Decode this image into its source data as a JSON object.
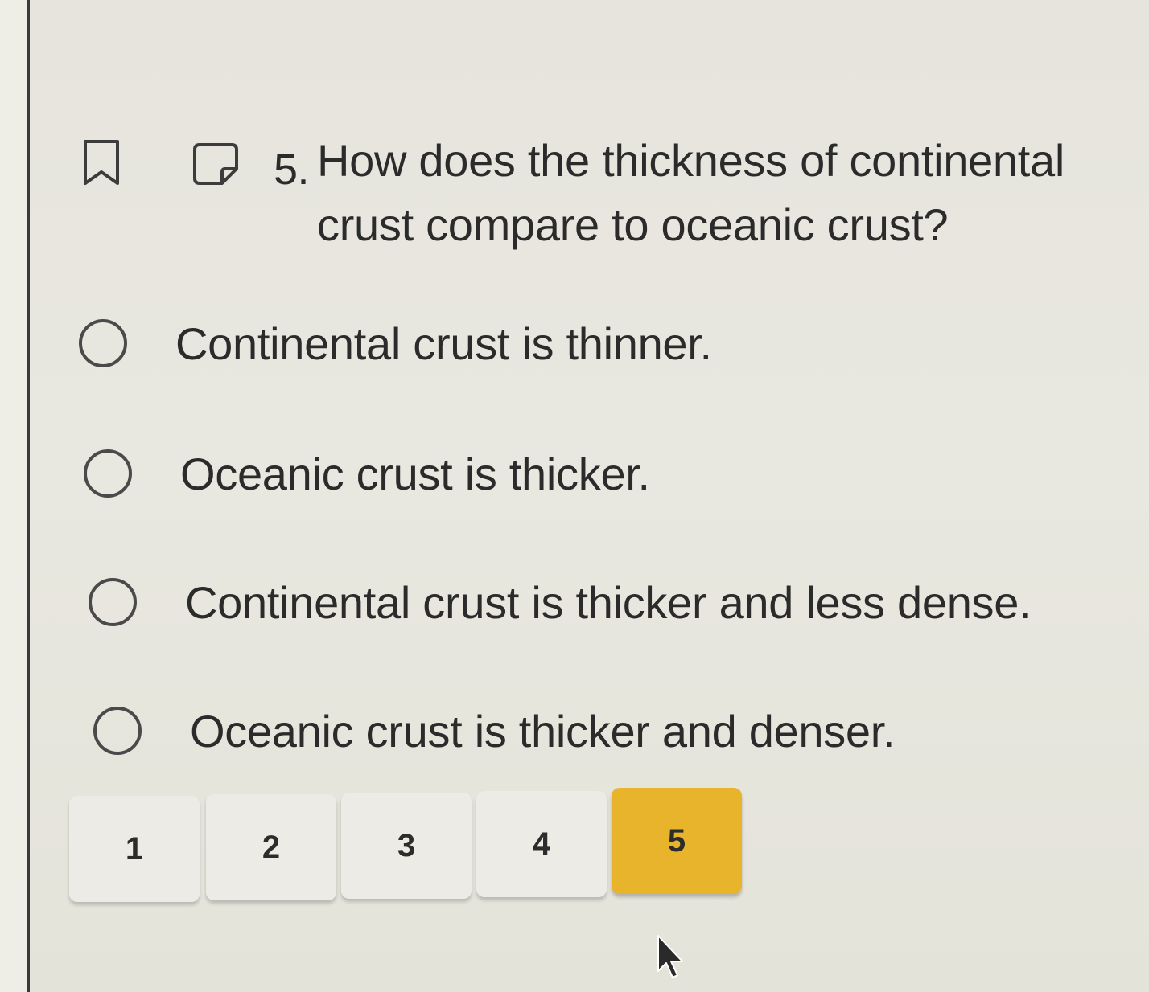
{
  "question": {
    "number": "5.",
    "text": "How does the thickness of continental crust compare to oceanic crust?"
  },
  "options": [
    {
      "label": "Continental crust is thinner."
    },
    {
      "label": "Oceanic crust is thicker."
    },
    {
      "label": "Continental crust is thicker and less dense."
    },
    {
      "label": "Oceanic crust is thicker and denser."
    }
  ],
  "pager": {
    "pages": [
      "1",
      "2",
      "3",
      "4",
      "5"
    ],
    "current": "5"
  },
  "colors": {
    "active_page": "#e8b42b",
    "page_button": "#ecebe5",
    "background": "#e8e7df",
    "text": "#2b2b2b"
  },
  "icons": [
    "bookmark-icon",
    "note-icon",
    "mouse-cursor-icon"
  ]
}
